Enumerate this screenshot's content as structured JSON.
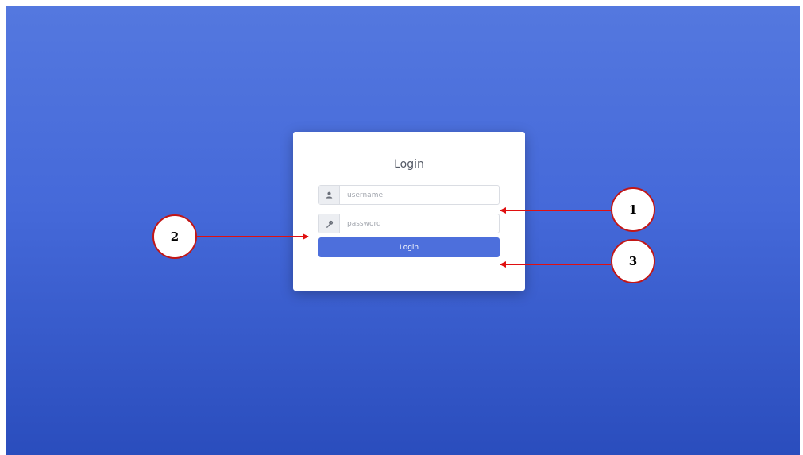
{
  "login_card": {
    "title": "Login",
    "username": {
      "placeholder": "username",
      "value": "",
      "icon": "user-icon"
    },
    "password": {
      "placeholder": "password",
      "value": "",
      "icon": "key-icon"
    },
    "submit_label": "Login"
  },
  "callouts": {
    "one": "1",
    "two": "2",
    "three": "3"
  },
  "colors": {
    "background_top": "#5478df",
    "background_bottom": "#2a4dbd",
    "button": "#4d6fdc",
    "callout_stroke": "#c21616",
    "arrow": "#e01010"
  }
}
